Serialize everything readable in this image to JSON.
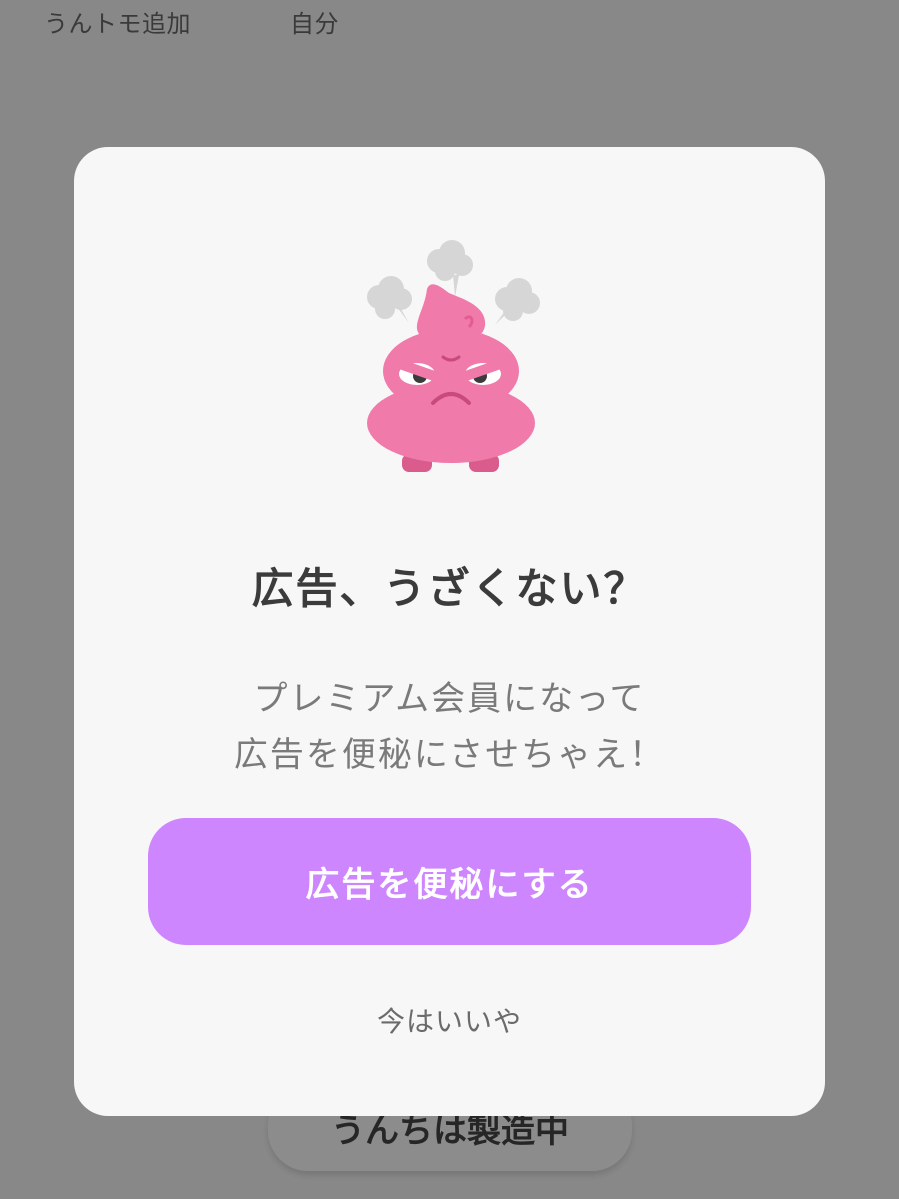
{
  "top_tabs": {
    "add_friend": "うんトモ追加",
    "self": "自分"
  },
  "background_button": {
    "label": "うんちは製造中"
  },
  "modal": {
    "title": "広告、うざくない？",
    "body_line1": "プレミアム会員になって",
    "body_line2": "広告を便秘にさせちゃえ！",
    "primary_label": "広告を便秘にする",
    "secondary_label": "今はいいや"
  },
  "colors": {
    "overlay": "#888888",
    "modal_bg": "#f7f7f8",
    "primary": "#cd86fd",
    "mascot": "#f07aaa"
  },
  "icons": {
    "mascot": "angry-poop-mascot-icon"
  }
}
